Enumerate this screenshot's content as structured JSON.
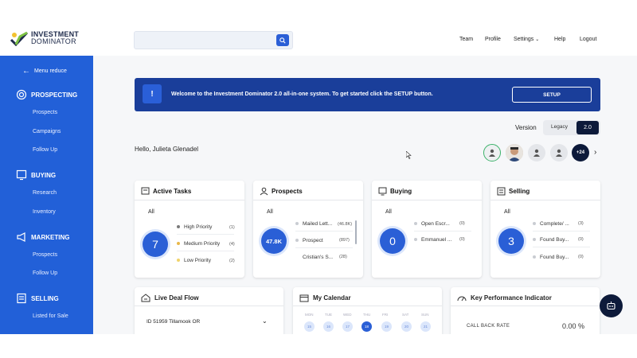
{
  "brand": {
    "line1": "INVESTMENT",
    "line2": "DOMINATOR"
  },
  "search": {
    "placeholder": ""
  },
  "nav": {
    "team": "Team",
    "profile": "Profile",
    "settings": "Settings",
    "help": "Help",
    "logout": "Logout"
  },
  "sidebar": {
    "menu_reduce": "Menu reduce",
    "sections": [
      {
        "label": "PROSPECTING",
        "items": [
          "Prospects",
          "Campaigns",
          "Follow Up"
        ]
      },
      {
        "label": "BUYING",
        "items": [
          "Research",
          "Inventory"
        ]
      },
      {
        "label": "MARKETING",
        "items": [
          "Prospects",
          "Follow Up"
        ]
      },
      {
        "label": "SELLING",
        "items": [
          "Listed for Sale"
        ]
      }
    ]
  },
  "banner": {
    "icon": "!",
    "text": "Welcome to the Investment Dominator 2.0 all-in-one system. To get started click the SETUP button.",
    "button": "SETUP"
  },
  "version": {
    "label": "Version",
    "legacy": "Legacy",
    "current": "2.0"
  },
  "greeting": "Hello, Julieta Glenadel",
  "team_avatars": {
    "more": "+24"
  },
  "cards": {
    "active_tasks": {
      "title": "Active Tasks",
      "filter": "All",
      "total": "7",
      "items": [
        {
          "label": "High Priority",
          "count": "(1)",
          "color": "#7a7a7a"
        },
        {
          "label": "Medium Priority",
          "count": "(4)",
          "color": "#e8b84a"
        },
        {
          "label": "Low Priority",
          "count": "(2)",
          "color": "#f0d36a"
        }
      ]
    },
    "prospects": {
      "title": "Prospects",
      "filter": "All",
      "total": "47.8K",
      "items": [
        {
          "label": "Mailed Lett...",
          "count": "(46.8K)"
        },
        {
          "label": "Prospect",
          "count": "(897)"
        },
        {
          "label": "Cristian's S...",
          "count": "(28)"
        }
      ]
    },
    "buying": {
      "title": "Buying",
      "filter": "All",
      "total": "0",
      "items": [
        {
          "label": "Open Escr...",
          "count": "(0)"
        },
        {
          "label": "Emmanuel ...",
          "count": "(0)"
        }
      ]
    },
    "selling": {
      "title": "Selling",
      "filter": "All",
      "total": "3",
      "items": [
        {
          "label": "Complete/ ...",
          "count": "(3)"
        },
        {
          "label": "Found Buy...",
          "count": "(0)"
        },
        {
          "label": "Found Buy...",
          "count": "(0)"
        }
      ]
    }
  },
  "live_deal_flow": {
    "title": "Live Deal Flow",
    "selected": "ID 51959 Tillamook OR"
  },
  "calendar": {
    "title": "My Calendar",
    "days": [
      "MON",
      "TUE",
      "WED",
      "THU",
      "FRI",
      "SAT",
      "SUN"
    ],
    "dates": [
      "15",
      "16",
      "17",
      "18",
      "19",
      "20",
      "21"
    ]
  },
  "kpi": {
    "title": "Key Performance Indicator",
    "label": "CALL BACK RATE",
    "value": "0.00 %"
  },
  "colors": {
    "sidebar": "#2260d8",
    "banner": "#1a3e9a",
    "accent": "#2a5fd6",
    "dark": "#0d1a3a"
  }
}
